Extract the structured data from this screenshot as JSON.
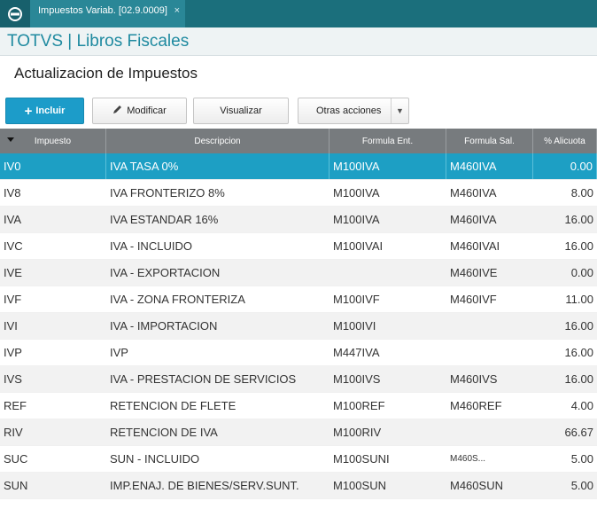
{
  "window": {
    "tab_title": "Impuestos Variab. [02.9.0009]",
    "tab_close": "×"
  },
  "app": {
    "title": "TOTVS | Libros Fiscales"
  },
  "page": {
    "title": "Actualizacion de Impuestos"
  },
  "toolbar": {
    "incluir_icon": "+",
    "incluir_label": "Incluir",
    "modificar_label": "Modificar",
    "visualizar_label": "Visualizar",
    "otras_label": "Otras acciones",
    "otras_arrow": "▼"
  },
  "grid": {
    "headers": [
      "Impuesto",
      "Descripcion",
      "Formula Ent.",
      "Formula Sal.",
      "% Alicuota"
    ],
    "rows": [
      [
        "IV0",
        "IVA TASA 0%",
        "M100IVA",
        "M460IVA",
        "0.00"
      ],
      [
        "IV8",
        "IVA FRONTERIZO 8%",
        "M100IVA",
        "M460IVA",
        "8.00"
      ],
      [
        "IVA",
        "IVA ESTANDAR  16%",
        "M100IVA",
        "M460IVA",
        "16.00"
      ],
      [
        "IVC",
        "IVA - INCLUIDO",
        "M100IVAI",
        "M460IVAI",
        "16.00"
      ],
      [
        "IVE",
        "IVA - EXPORTACION",
        "",
        "M460IVE",
        "0.00"
      ],
      [
        "IVF",
        "IVA - ZONA FRONTERIZA",
        "M100IVF",
        "M460IVF",
        "11.00"
      ],
      [
        "IVI",
        "IVA - IMPORTACION",
        "M100IVI",
        "",
        "16.00"
      ],
      [
        "IVP",
        "IVP",
        "M447IVA",
        "",
        "16.00"
      ],
      [
        "IVS",
        "IVA - PRESTACION DE SERVICIOS",
        "M100IVS",
        "M460IVS",
        "16.00"
      ],
      [
        "REF",
        "RETENCION DE FLETE",
        "M100REF",
        "M460REF",
        "4.00"
      ],
      [
        "RIV",
        "RETENCION DE IVA",
        "M100RIV",
        "",
        "66.67"
      ],
      [
        "SUC",
        "SUN - INCLUIDO",
        "M100SUNI",
        "M460S...",
        "5.00"
      ],
      [
        "SUN",
        "IMP.ENAJ. DE BIENES/SERV.SUNT.",
        "M100SUN",
        "M460SUN",
        "5.00"
      ]
    ]
  },
  "colors": {
    "accent": "#1d9fc4",
    "topbar": "#1b6f7c",
    "title": "#1f8aa0"
  }
}
